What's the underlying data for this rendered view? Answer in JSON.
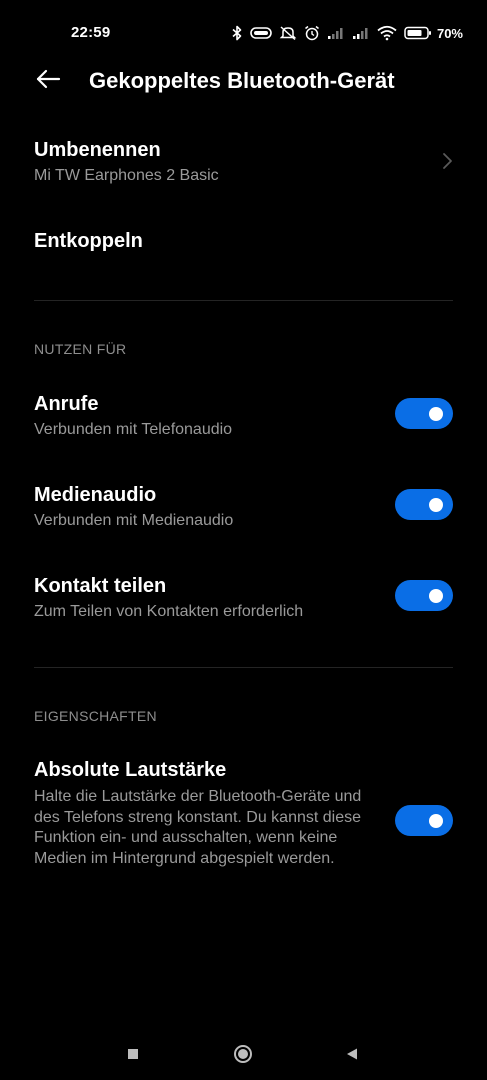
{
  "status_bar": {
    "time": "22:59",
    "battery_percent": "70%",
    "icons": [
      "bluetooth-icon",
      "headset-battery-icon",
      "silent-icon",
      "alarm-icon",
      "signal-1-icon",
      "signal-2-icon",
      "wifi-icon",
      "battery-icon"
    ]
  },
  "header": {
    "back_icon": "arrow-left-icon",
    "title": "Gekoppeltes Bluetooth-Gerät"
  },
  "device": {
    "rename_label": "Umbenennen",
    "device_name": "Mi TW Earphones 2 Basic",
    "unpair_label": "Entkoppeln"
  },
  "use_for": {
    "section_label": "NUTZEN FÜR",
    "items": [
      {
        "title": "Anrufe",
        "subtitle": "Verbunden mit Telefonaudio",
        "enabled": true
      },
      {
        "title": "Medienaudio",
        "subtitle": "Verbunden mit Medienaudio",
        "enabled": true
      },
      {
        "title": "Kontakt teilen",
        "subtitle": "Zum Teilen von Kontakten erforderlich",
        "enabled": true
      }
    ]
  },
  "properties": {
    "section_label": "EIGENSCHAFTEN",
    "absolute_volume": {
      "title": "Absolute Lautstärke",
      "description": "Halte die Lautstärke der Bluetooth-Geräte und des Telefons streng konstant. Du kannst diese Funktion ein- und ausschalten, wenn keine Medien im Hintergrund abgespielt werden.",
      "enabled": true
    }
  },
  "nav_bar": {
    "icons": [
      "recents-square-icon",
      "home-circle-icon",
      "back-triangle-icon"
    ]
  },
  "colors": {
    "background": "#000000",
    "accent_toggle": "#0a6ee6",
    "secondary_text": "#9a9a9a",
    "section_text": "#8e8e8e"
  }
}
